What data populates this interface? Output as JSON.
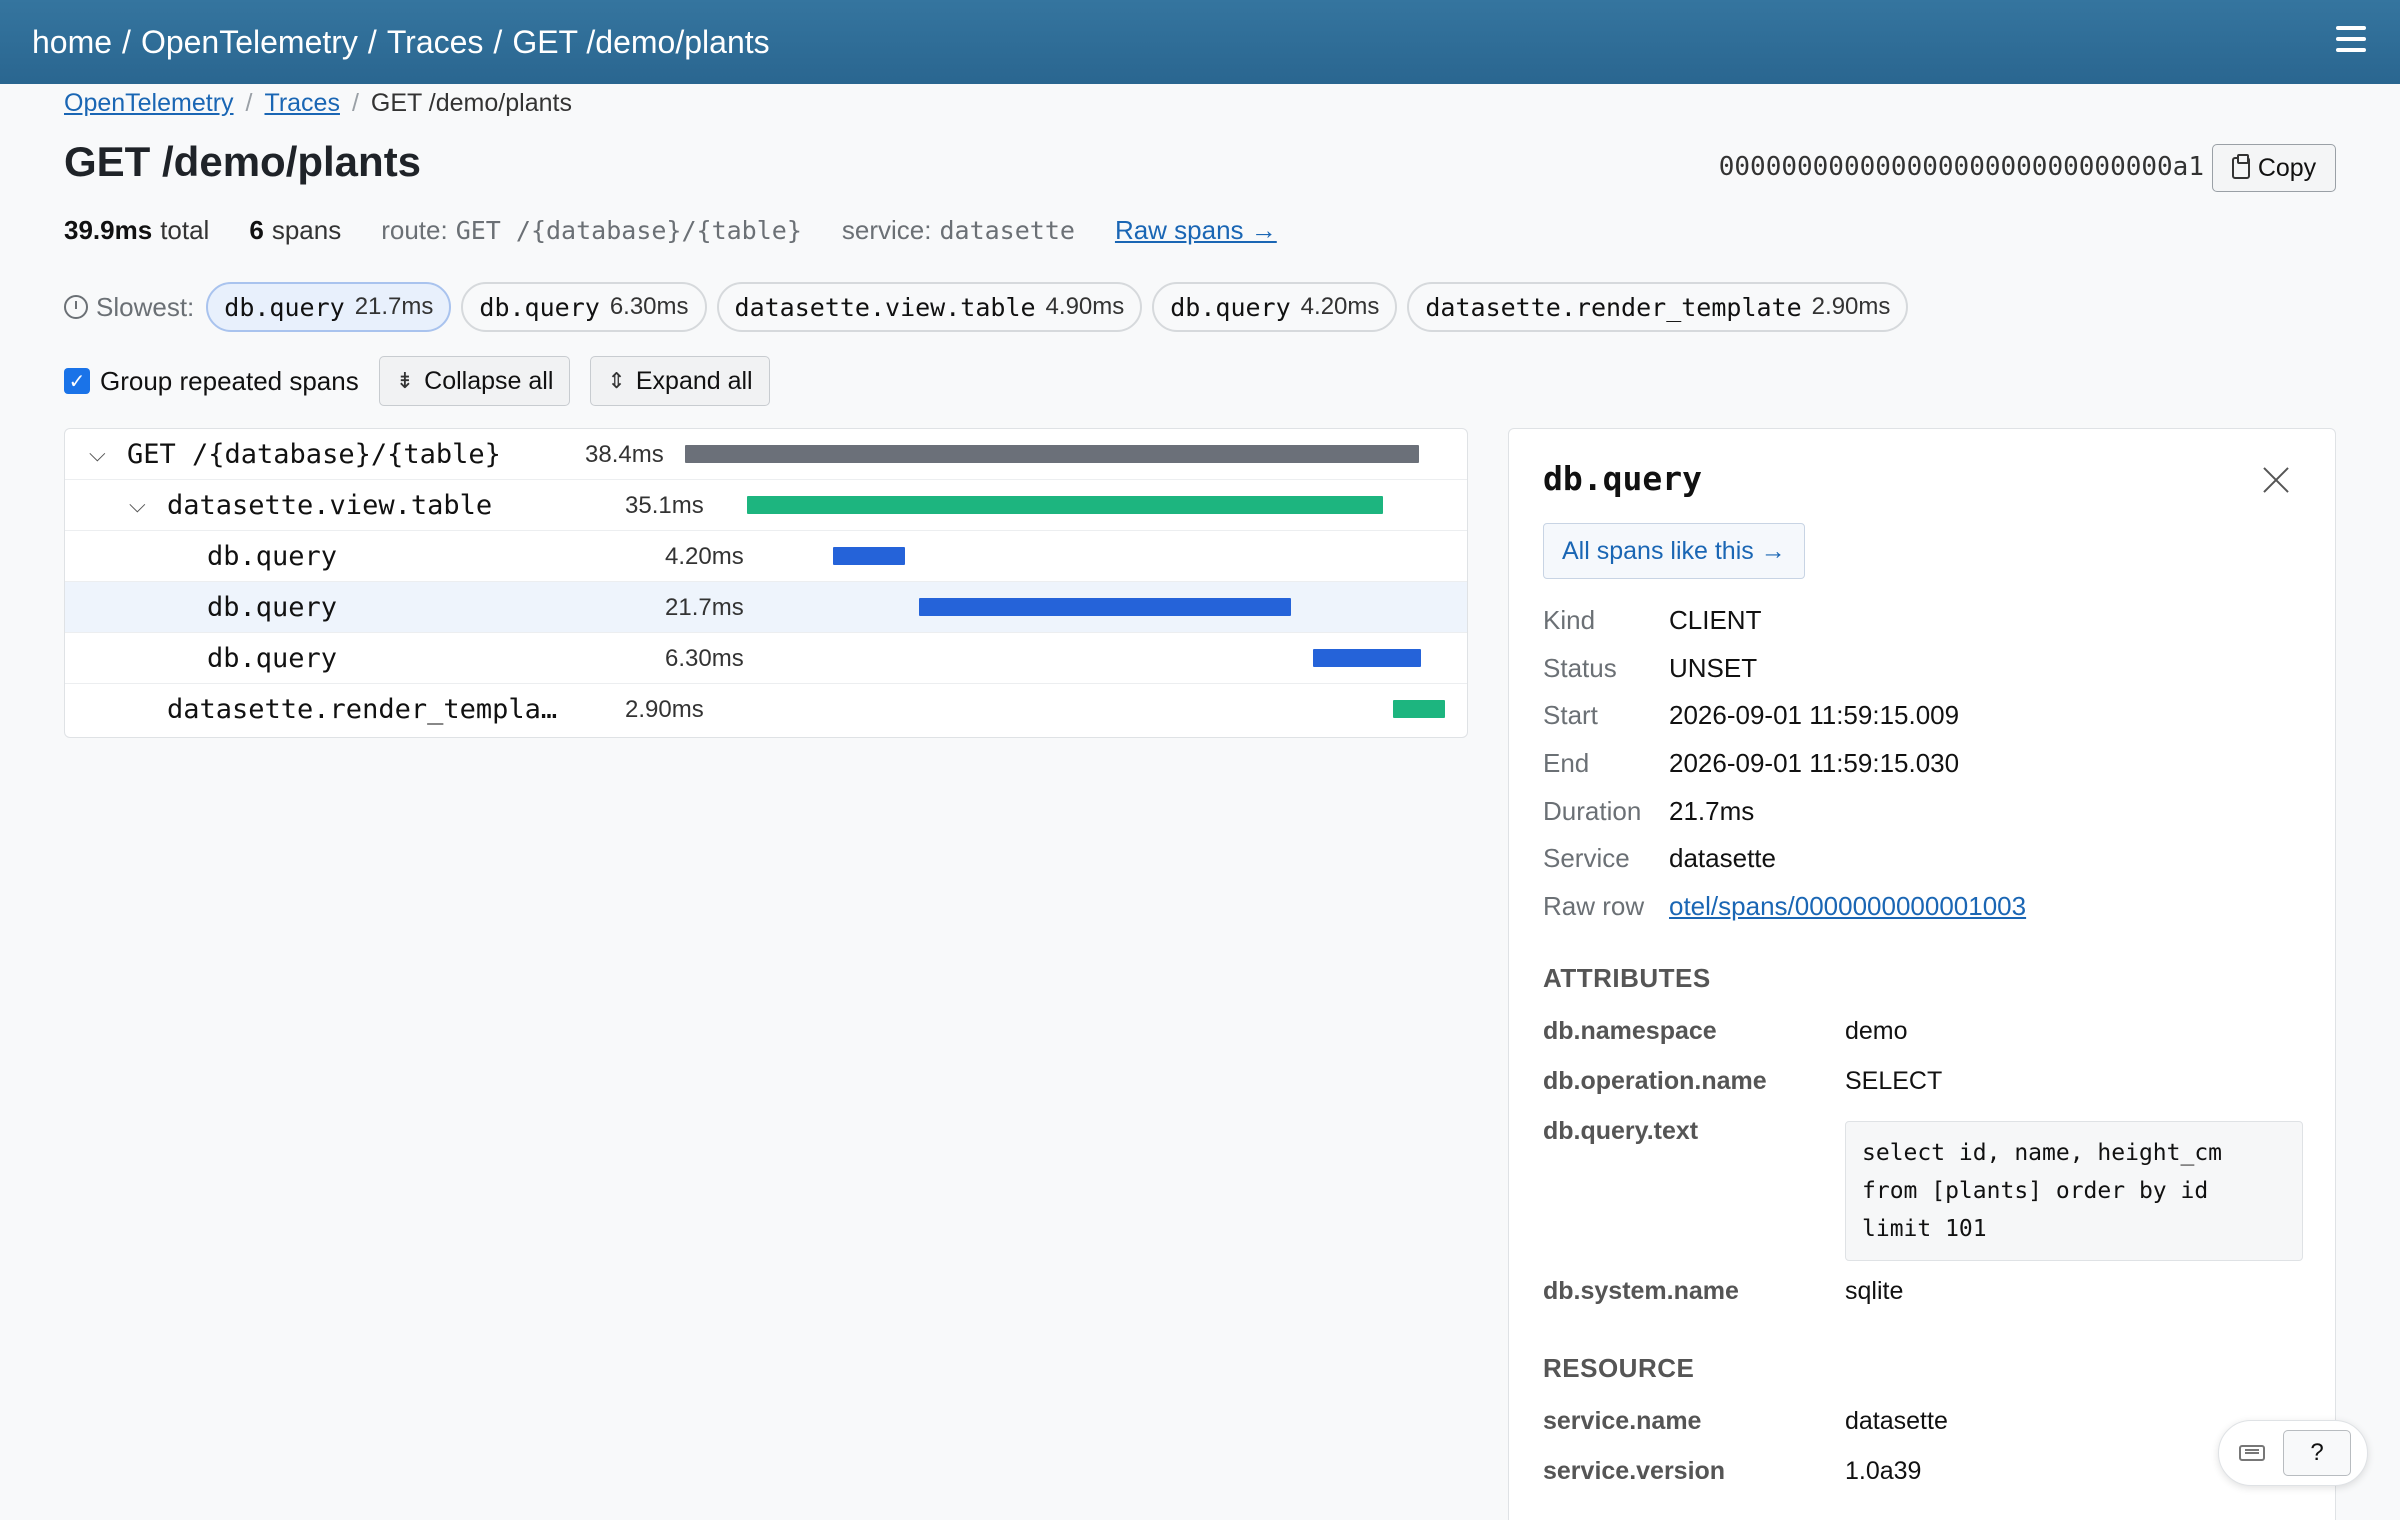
{
  "header": {
    "crumbs": [
      "home",
      "OpenTelemetry",
      "Traces",
      "GET /demo/plants"
    ]
  },
  "subcrumbs": {
    "link1": "OpenTelemetry",
    "link2": "Traces",
    "current": "GET /demo/plants"
  },
  "page_title": "GET /demo/plants",
  "trace_id": "00000000000000000000000000000a1",
  "copy_label": "Copy",
  "summary": {
    "total_value": "39.9ms",
    "total_label": "total",
    "spans_value": "6",
    "spans_label": "spans",
    "route_label": "route:",
    "route_value": "GET /{database}/{table}",
    "service_label": "service:",
    "service_value": "datasette",
    "raw_spans_link": "Raw spans →"
  },
  "slowest": {
    "label": "Slowest:",
    "pills": [
      {
        "name": "db.query",
        "duration": "21.7ms"
      },
      {
        "name": "db.query",
        "duration": "6.30ms"
      },
      {
        "name": "datasette.view.table",
        "duration": "4.90ms"
      },
      {
        "name": "db.query",
        "duration": "4.20ms"
      },
      {
        "name": "datasette.render_template",
        "duration": "2.90ms"
      }
    ]
  },
  "controls": {
    "group_label": "Group repeated spans",
    "collapse_label": "Collapse all",
    "expand_label": "Expand all"
  },
  "spans": [
    {
      "name": "GET /{database}/{table}",
      "duration": "38.4ms",
      "color": "#6b7079"
    },
    {
      "name": "datasette.view.table",
      "duration": "35.1ms",
      "color": "#1db57f"
    },
    {
      "name": "db.query",
      "duration": "4.20ms",
      "color": "#2563d9"
    },
    {
      "name": "db.query",
      "duration": "21.7ms",
      "color": "#2563d9"
    },
    {
      "name": "db.query",
      "duration": "6.30ms",
      "color": "#2563d9"
    },
    {
      "name": "datasette.render_templa…",
      "duration": "2.90ms",
      "color": "#1db57f"
    }
  ],
  "detail": {
    "title": "db.query",
    "all_like_label": "All spans like this →",
    "fields": [
      {
        "key": "Kind",
        "value": "CLIENT"
      },
      {
        "key": "Status",
        "value": "UNSET"
      },
      {
        "key": "Start",
        "value": "2026-09-01 11:59:15.009"
      },
      {
        "key": "End",
        "value": "2026-09-01 11:59:15.030"
      },
      {
        "key": "Duration",
        "value": "21.7ms"
      },
      {
        "key": "Service",
        "value": "datasette"
      },
      {
        "key": "Raw row",
        "value": "otel/spans/0000000000001003"
      }
    ],
    "attributes_heading": "ATTRIBUTES",
    "attributes": [
      {
        "key": "db.namespace",
        "value": "demo"
      },
      {
        "key": "db.operation.name",
        "value": "SELECT"
      },
      {
        "key": "db.query.text",
        "value": "select id, name, height_cm\nfrom [plants] order by id\nlimit 101"
      },
      {
        "key": "db.system.name",
        "value": "sqlite"
      }
    ],
    "resource_heading": "RESOURCE",
    "resource": [
      {
        "key": "service.name",
        "value": "datasette"
      },
      {
        "key": "service.version",
        "value": "1.0a39"
      }
    ]
  },
  "help_label": "?"
}
